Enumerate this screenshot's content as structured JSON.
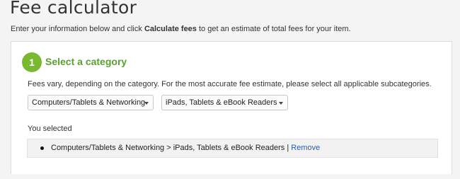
{
  "page": {
    "title": "Fee calculator",
    "intro_before": "Enter your information below and click ",
    "intro_bold": "Calculate fees",
    "intro_after": " to get an estimate of total fees for your item."
  },
  "step": {
    "number": "1",
    "title": "Select a category",
    "description": "Fees vary, depending on the category. For the most accurate fee estimate, please select all applicable subcategories."
  },
  "selects": {
    "category": "Computers/Tablets & Networking",
    "subcategory": "iPads, Tablets & eBook Readers"
  },
  "selection": {
    "label": "You selected",
    "path": "Computers/Tablets & Networking > iPads, Tablets & eBook Readers",
    "separator": " | ",
    "remove_label": "Remove"
  },
  "colors": {
    "accent_green": "#79b92f",
    "title_green": "#5aa02c",
    "link_blue": "#2b5ea8"
  }
}
